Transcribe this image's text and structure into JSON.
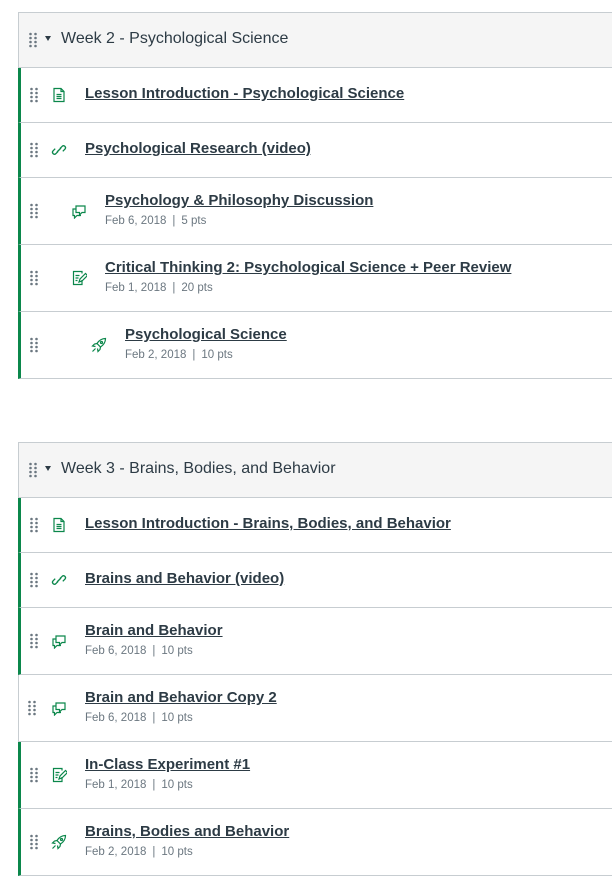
{
  "colors": {
    "published": "#0B874B",
    "text": "#2D3B45",
    "muted": "#6B7780",
    "border": "#C7CDD1",
    "header_bg": "#F5F5F5"
  },
  "modules": [
    {
      "title": "Week 2 - Psychological Science",
      "items": [
        {
          "icon": "page-icon",
          "title": "Lesson Introduction - Psychological Science",
          "indent": 0,
          "published": true
        },
        {
          "icon": "link-icon",
          "title": "Psychological Research (video)",
          "indent": 0,
          "published": true
        },
        {
          "icon": "discussion-icon",
          "title": "Psychology & Philosophy Discussion",
          "indent": 1,
          "published": true,
          "date": "Feb 6, 2018",
          "points": "5 pts"
        },
        {
          "icon": "assignment-icon",
          "title": "Critical Thinking 2: Psychological Science + Peer Review",
          "indent": 1,
          "published": true,
          "date": "Feb 1, 2018",
          "points": "20 pts"
        },
        {
          "icon": "quiz-icon",
          "title": "Psychological Science",
          "indent": 2,
          "published": true,
          "date": "Feb 2, 2018",
          "points": "10 pts"
        }
      ]
    },
    {
      "title": "Week 3 - Brains, Bodies, and Behavior",
      "items": [
        {
          "icon": "page-icon",
          "title": "Lesson Introduction - Brains, Bodies, and Behavior",
          "indent": 0,
          "published": true
        },
        {
          "icon": "link-icon",
          "title": "Brains and Behavior (video)",
          "indent": 0,
          "published": true
        },
        {
          "icon": "discussion-icon",
          "title": "Brain and Behavior",
          "indent": 0,
          "published": true,
          "date": "Feb 6, 2018",
          "points": "10 pts"
        },
        {
          "icon": "discussion-icon",
          "title": "Brain and Behavior Copy 2",
          "indent": 0,
          "published": false,
          "date": "Feb 6, 2018",
          "points": "10 pts"
        },
        {
          "icon": "assignment-icon",
          "title": "In-Class Experiment #1",
          "indent": 0,
          "published": true,
          "date": "Feb 1, 2018",
          "points": "10 pts"
        },
        {
          "icon": "quiz-icon",
          "title": "Brains, Bodies and Behavior",
          "indent": 0,
          "published": true,
          "date": "Feb 2, 2018",
          "points": "10 pts"
        }
      ]
    }
  ]
}
